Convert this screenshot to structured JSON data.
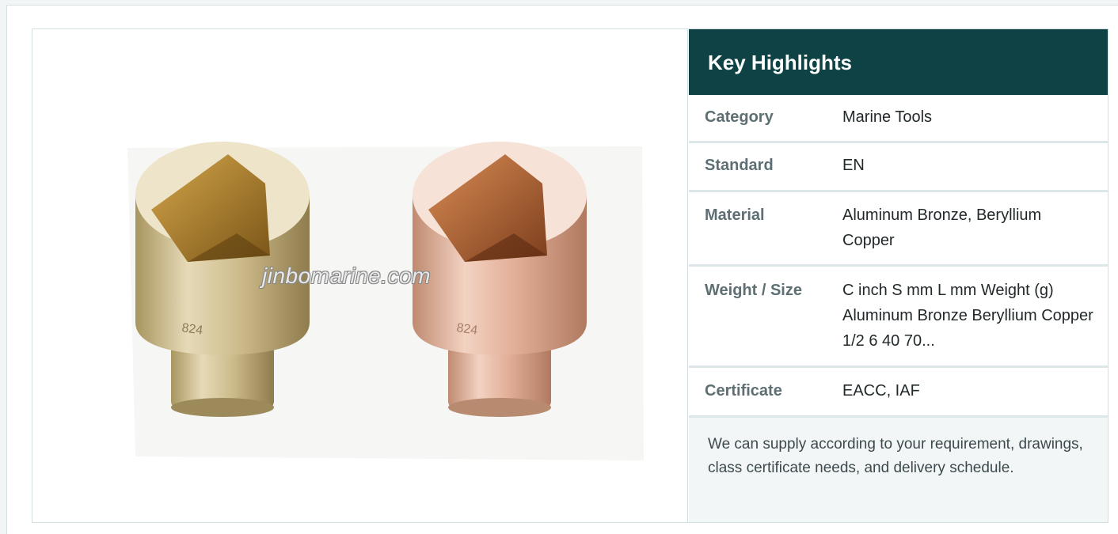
{
  "image": {
    "alt_subject": "Two non-sparking socket tools",
    "watermark": "jinbomarine.com",
    "left_marking": "824",
    "right_marking": "824"
  },
  "highlights": {
    "title": "Key Highlights",
    "rows": [
      {
        "key": "Category",
        "value": "Marine Tools"
      },
      {
        "key": "Standard",
        "value": "EN"
      },
      {
        "key": "Material",
        "value": "Aluminum Bronze, Beryllium Copper"
      },
      {
        "key": "Weight / Size",
        "value": "C inch S mm L mm Weight (g) Aluminum Bronze Beryllium Copper 1/2 6 40 70..."
      },
      {
        "key": "Certificate",
        "value": "EACC, IAF"
      }
    ],
    "note": "We can supply according to your requirement, drawings, class certificate needs, and delivery schedule."
  },
  "colors": {
    "header_bg": "#0e4244",
    "aluminum_bronze": "#c9b88a",
    "beryllium_copper": "#d9a58c"
  }
}
